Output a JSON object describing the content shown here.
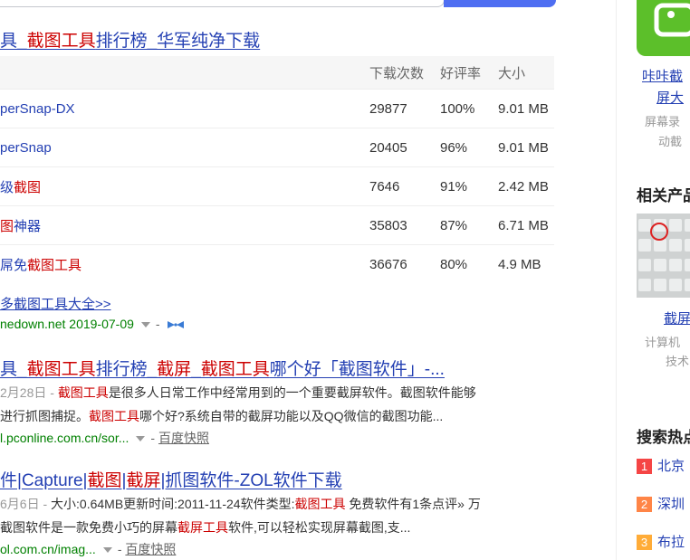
{
  "result1": {
    "title_parts": [
      {
        "t": "具_",
        "em": false
      },
      {
        "t": "截图工具",
        "em": true
      },
      {
        "t": "排行榜_华军纯净下载",
        "em": false
      }
    ],
    "table": {
      "headers": [
        "下载次数",
        "好评率",
        "大小"
      ],
      "rows": [
        {
          "name_parts": [
            {
              "t": "perSnap-DX",
              "em": false
            }
          ],
          "downloads": "29877",
          "rating": "100%",
          "size": "9.01 MB"
        },
        {
          "name_parts": [
            {
              "t": "perSnap",
              "em": false
            }
          ],
          "downloads": "20405",
          "rating": "96%",
          "size": "9.01 MB"
        },
        {
          "name_parts": [
            {
              "t": "级",
              "em": false
            },
            {
              "t": "截图",
              "em": true
            }
          ],
          "downloads": "7646",
          "rating": "91%",
          "size": "2.42 MB"
        },
        {
          "name_parts": [
            {
              "t": "图",
              "em": true
            },
            {
              "t": "神器",
              "em": false
            }
          ],
          "downloads": "35803",
          "rating": "87%",
          "size": "6.71 MB"
        },
        {
          "name_parts": [
            {
              "t": "屌免",
              "em": false
            },
            {
              "t": "截图工具",
              "em": true
            }
          ],
          "downloads": "36676",
          "rating": "80%",
          "size": "4.9 MB"
        }
      ]
    },
    "more_link": "多截图工具大全>>",
    "source": "nedown.net 2019-07-09"
  },
  "result2": {
    "title_parts": [
      {
        "t": "具_",
        "em": false
      },
      {
        "t": "截图工具",
        "em": true
      },
      {
        "t": "排行榜_",
        "em": false
      },
      {
        "t": "截屏",
        "em": true
      },
      {
        "t": "_",
        "em": false
      },
      {
        "t": "截图工具",
        "em": true
      },
      {
        "t": "哪个好「截图软件」-...",
        "em": false
      }
    ],
    "line1_parts": [
      {
        "t": "2月28日 - ",
        "em": false,
        "gray": true
      },
      {
        "t": "截图工具",
        "em": true
      },
      {
        "t": "是很多人日常工作中经常用到的一个重要截屏软件。截图软件能够",
        "em": false
      }
    ],
    "line2_parts": [
      {
        "t": "进行抓图捕捉。",
        "em": false
      },
      {
        "t": "截图工具",
        "em": true
      },
      {
        "t": "哪个好?系统自带的截屏功能以及QQ微信的截图功能...",
        "em": false
      }
    ],
    "url": "l.pconline.com.cn/sor...",
    "snapshot": "百度快照"
  },
  "result3": {
    "title_parts": [
      {
        "t": "件|",
        "em": false
      },
      {
        "t": "Capture",
        "em": false
      },
      {
        "t": "|",
        "em": false
      },
      {
        "t": "截图",
        "em": true
      },
      {
        "t": "|",
        "em": false
      },
      {
        "t": "截屏",
        "em": true
      },
      {
        "t": "|抓图软件-ZOL软件下载",
        "em": false
      }
    ],
    "line1_parts": [
      {
        "t": "6月6日 - ",
        "em": false,
        "gray": true
      },
      {
        "t": "大小:0.64MB更新时间:2011-11-24软件类型:",
        "em": false
      },
      {
        "t": "截图工具",
        "em": true
      },
      {
        "t": " 免费软件有1条点评» 万",
        "em": false
      }
    ],
    "line2_parts": [
      {
        "t": "截图软件是一款免费小巧的屏幕",
        "em": false
      },
      {
        "t": "截屏工具",
        "em": true
      },
      {
        "t": "软件,可以轻松实现屏幕截图,支...",
        "em": false
      }
    ],
    "url": "ol.com.cn/imag...",
    "snapshot": "百度快照"
  },
  "sidebar": {
    "card1": {
      "title1": "咔咔截",
      "title2": "屏大",
      "desc1": "屏幕录",
      "desc2": "动截"
    },
    "related_heading": "相关产品",
    "card2": {
      "title": "截屏",
      "desc1": "计算机",
      "desc2": "技术"
    },
    "hot_heading": "搜索热点",
    "hot": [
      {
        "rank": "1",
        "text": "北京",
        "color": "#f54545"
      },
      {
        "rank": "2",
        "text": "深圳",
        "color": "#ff8547"
      },
      {
        "rank": "3",
        "text": "布拉",
        "color": "#ffac38"
      }
    ]
  },
  "colors": {
    "link": "#2440b3",
    "highlight": "#cc0000",
    "url_green": "#008000",
    "search_blue": "#4e6ef2"
  }
}
